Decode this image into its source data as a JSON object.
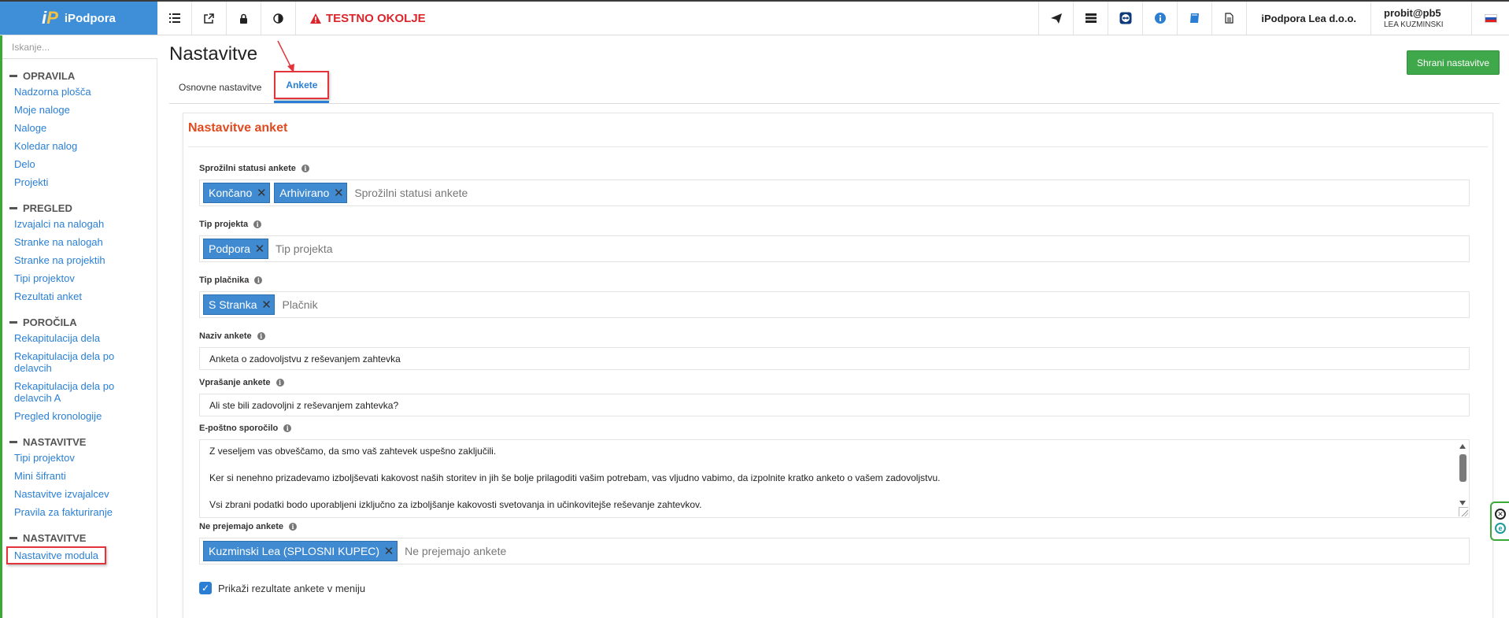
{
  "topbar": {
    "brand_name": "iPodpora",
    "test_env_label": "TESTNO OKOLJE",
    "company": "iPodpora Lea d.o.o.",
    "user_login": "probit@pb5",
    "user_name": "LEA KUZMINSKI",
    "icons": [
      "list-icon",
      "external-link-icon",
      "lock-icon",
      "contrast-icon",
      "send-icon",
      "server-icon",
      "teamviewer-icon",
      "info-icon",
      "book-icon",
      "document-icon",
      "slovenia-flag-icon"
    ],
    "brand_color": "#3f8fd8",
    "test_color": "#d9262d"
  },
  "sidebar": {
    "search_placeholder": "Iskanje...",
    "sections": [
      {
        "title": "OPRAVILA",
        "items": [
          "Nadzorna plošča",
          "Moje naloge",
          "Naloge",
          "Koledar nalog",
          "Delo",
          "Projekti"
        ]
      },
      {
        "title": "PREGLED",
        "items": [
          "Izvajalci na nalogah",
          "Stranke na nalogah",
          "Stranke na projektih",
          "Tipi projektov",
          "Rezultati anket"
        ]
      },
      {
        "title": "POROČILA",
        "items": [
          "Rekapitulacija dela",
          "Rekapitulacija dela po delavcih",
          "Rekapitulacija dela po delavcih A",
          "Pregled kronologije"
        ]
      },
      {
        "title": "NASTAVITVE",
        "items": [
          "Tipi projektov",
          "Mini šifranti",
          "Nastavitve izvajalcev",
          "Pravila za fakturiranje"
        ]
      },
      {
        "title": "NASTAVITVE",
        "items": [
          "Nastavitve modula"
        ]
      }
    ],
    "link_color": "#2a7fd4",
    "accent_color": "#3aa935"
  },
  "main": {
    "page_title": "Nastavitve",
    "save_label": "Shrani nastavitve",
    "tabs": [
      {
        "label": "Osnovne nastavitve",
        "active": false
      },
      {
        "label": "Ankete",
        "active": true
      }
    ],
    "panel_title": "Nastavitve anket",
    "fields": {
      "trigger_statuses": {
        "label": "Sprožilni statusi ankete",
        "tags": [
          "Končano",
          "Arhivirano"
        ],
        "placeholder": "Sprožilni statusi ankete"
      },
      "project_type": {
        "label": "Tip projekta",
        "tags": [
          "Podpora"
        ],
        "placeholder": "Tip projekta"
      },
      "payer_type": {
        "label": "Tip plačnika",
        "tags": [
          "S Stranka"
        ],
        "placeholder": "Plačnik"
      },
      "survey_name": {
        "label": "Naziv ankete",
        "value": "Anketa o zadovoljstvu z reševanjem zahtevka"
      },
      "survey_question": {
        "label": "Vprašanje ankete",
        "value": "Ali ste bili zadovoljni z reševanjem zahtevka?"
      },
      "email_message": {
        "label": "E-poštno sporočilo",
        "lines": [
          "Z veseljem vas obveščamo, da smo vaš zahtevek uspešno zaključili.",
          "Ker si nenehno prizadevamo izboljševati kakovost naših storitev in jih še bolje prilagoditi vašim potrebam, vas vljudno vabimo, da izpolnite kratko anketo o vašem zadovoljstvu.",
          "Vsi zbrani podatki bodo uporabljeni izključno za izboljšanje kakovosti svetovanja in učinkovitejše reševanje zahtevkov."
        ]
      },
      "excluded": {
        "label": "Ne prejemajo ankete",
        "tags": [
          "Kuzminski Lea (SPLOSNI KUPEC)"
        ],
        "placeholder": "Ne prejemajo ankete"
      }
    },
    "show_results_label": "Prikaži rezultate ankete v meniju",
    "show_results_checked": true,
    "title_color": "#e04a1f",
    "tag_color": "#3f8ad0",
    "save_color": "#3ea84a",
    "highlight_color": "#e2343a"
  }
}
